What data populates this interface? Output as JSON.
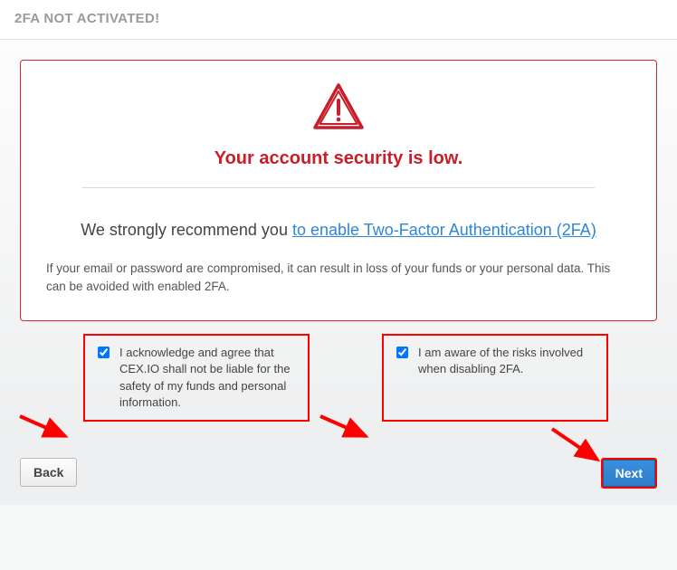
{
  "header": {
    "title": "2FA NOT ACTIVATED!"
  },
  "card": {
    "heading": "Your account security is low.",
    "recommend_prefix": "We strongly recommend you ",
    "recommend_link": "to enable Two-Factor Authentication (2FA)",
    "explain": "If your email or password are compromised, it can result in loss of your funds or your personal data. This can be avoided with enabled 2FA."
  },
  "checks": {
    "ack": "I acknowledge and agree that CEX.IO shall not be liable for the safety of my funds and personal information.",
    "aware": "I am aware of the risks involved when disabling 2FA."
  },
  "buttons": {
    "back": "Back",
    "next": "Next"
  },
  "colors": {
    "danger": "#c81e2a",
    "highlight_border": "#ff0000",
    "link": "#2f86d6",
    "next_bg": "#2d7cc9"
  }
}
